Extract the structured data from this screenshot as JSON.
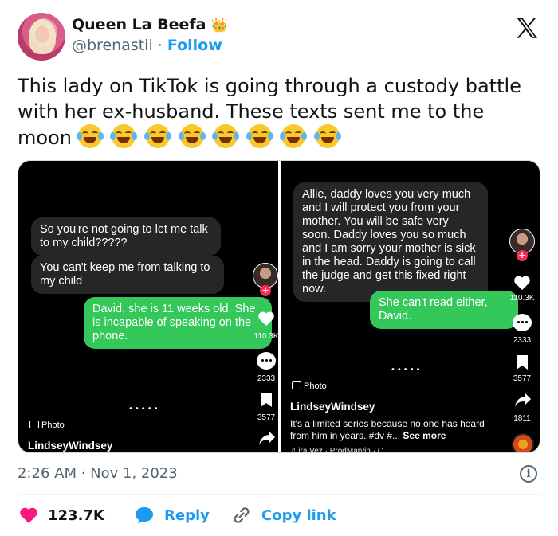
{
  "author": {
    "name": "Queen La Beefa",
    "crown_emoji": "👑",
    "handle": "@brenastii",
    "separator": "·",
    "follow_label": "Follow"
  },
  "tweet": {
    "text": "This lady on TikTok is going through a custody battle with her ex-husband. These texts sent me to the moon",
    "emoji_count": 8,
    "emoji_name": "face-with-tears-of-joy"
  },
  "media": {
    "left": {
      "messages": [
        {
          "type": "received",
          "text": "So you're not going to let me talk to my child?????"
        },
        {
          "type": "received",
          "text": "You can't keep me from talking to my child"
        },
        {
          "type": "sent",
          "text": "David, she is 11 weeks old. She is incapable of speaking on the phone."
        }
      ],
      "likes": "110.3K",
      "comments": "2333",
      "saves": "3577",
      "photo_label": "Photo",
      "username": "LindseyWindsey",
      "dots": "•••••"
    },
    "right": {
      "messages": [
        {
          "type": "received",
          "text": "Allie, daddy loves you very much and I will protect you from your mother. You will be safe very soon. Daddy loves you so much and I am sorry your mother is sick in the head. Daddy is going to call the judge and get this fixed right now."
        },
        {
          "type": "sent",
          "text": "She can't read either, David."
        }
      ],
      "likes": "110.3K",
      "comments": "2333",
      "saves": "3577",
      "shares": "1811",
      "photo_label": "Photo",
      "username": "LindseyWindsey",
      "caption": "It's a limited series because no one has heard from him in years. #dv #...",
      "see_more": "See more",
      "music": "♫ ira Vez · ProdMarvin · C",
      "dots": "•••••"
    }
  },
  "footer": {
    "timestamp": "2:26 AM · Nov 1, 2023",
    "info_icon": "i",
    "like_count": "123.7K",
    "reply_label": "Reply",
    "copy_label": "Copy link"
  },
  "colors": {
    "accent": "#1d9bf0",
    "like": "#f91880",
    "imessage_green": "#34c759",
    "imessage_gray": "#262629"
  }
}
